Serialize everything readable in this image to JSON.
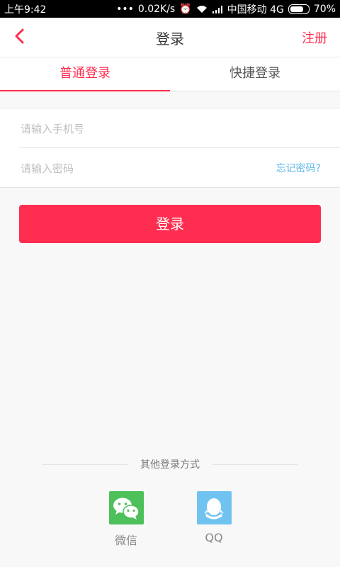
{
  "status_bar": {
    "time": "上午9:42",
    "network_speed": "0.02K/s",
    "carrier": "中国移动 4G",
    "battery": "70%"
  },
  "header": {
    "title": "登录",
    "register_label": "注册"
  },
  "tabs": [
    {
      "label": "普通登录",
      "active": true
    },
    {
      "label": "快捷登录",
      "active": false
    }
  ],
  "form": {
    "phone_placeholder": "请输入手机号",
    "password_placeholder": "请输入密码",
    "forgot_password": "忘记密码?"
  },
  "login_button": "登录",
  "other_login": {
    "title": "其他登录方式",
    "options": [
      {
        "label": "微信",
        "icon": "wechat-icon"
      },
      {
        "label": "QQ",
        "icon": "qq-icon"
      }
    ]
  },
  "colors": {
    "accent": "#ff2d4f",
    "link": "#5fb9e8",
    "wechat": "#4dc05a",
    "qq": "#70c3f0"
  }
}
